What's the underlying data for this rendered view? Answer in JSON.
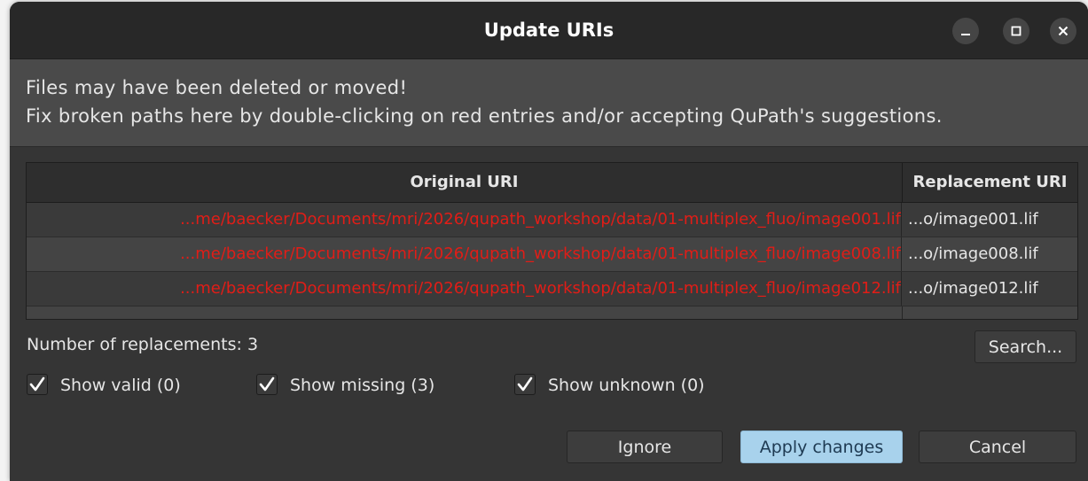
{
  "window": {
    "title": "Update URIs"
  },
  "header": {
    "line1": "Files may have been deleted or moved!",
    "line2": "Fix broken paths here by double-clicking on red entries and/or accepting QuPath's suggestions."
  },
  "table": {
    "columns": [
      "Original URI",
      "Replacement URI"
    ],
    "rows": [
      {
        "original": "...me/baecker/Documents/mri/2026/qupath_workshop/data/01-multiplex_fluo/image001.lif",
        "replacement": "...o/image001.lif"
      },
      {
        "original": "...me/baecker/Documents/mri/2026/qupath_workshop/data/01-multiplex_fluo/image008.lif",
        "replacement": "...o/image008.lif"
      },
      {
        "original": "...me/baecker/Documents/mri/2026/qupath_workshop/data/01-multiplex_fluo/image012.lif",
        "replacement": "...o/image012.lif"
      }
    ]
  },
  "status": {
    "replacements": "Number of replacements: 3"
  },
  "buttons": {
    "search": "Search...",
    "ignore": "Ignore",
    "apply": "Apply changes",
    "cancel": "Cancel"
  },
  "filters": [
    {
      "label": "Show valid (0)",
      "checked": true
    },
    {
      "label": "Show missing (3)",
      "checked": true
    },
    {
      "label": "Show unknown (0)",
      "checked": true
    }
  ],
  "icons": {
    "minimize": "minimize-icon",
    "maximize": "maximize-icon",
    "close": "close-icon",
    "checkmark": "checkmark-icon"
  },
  "colors": {
    "missing_entry": "#e11d17",
    "primary_button": "#a8d2ec",
    "window_bg": "#353535"
  }
}
